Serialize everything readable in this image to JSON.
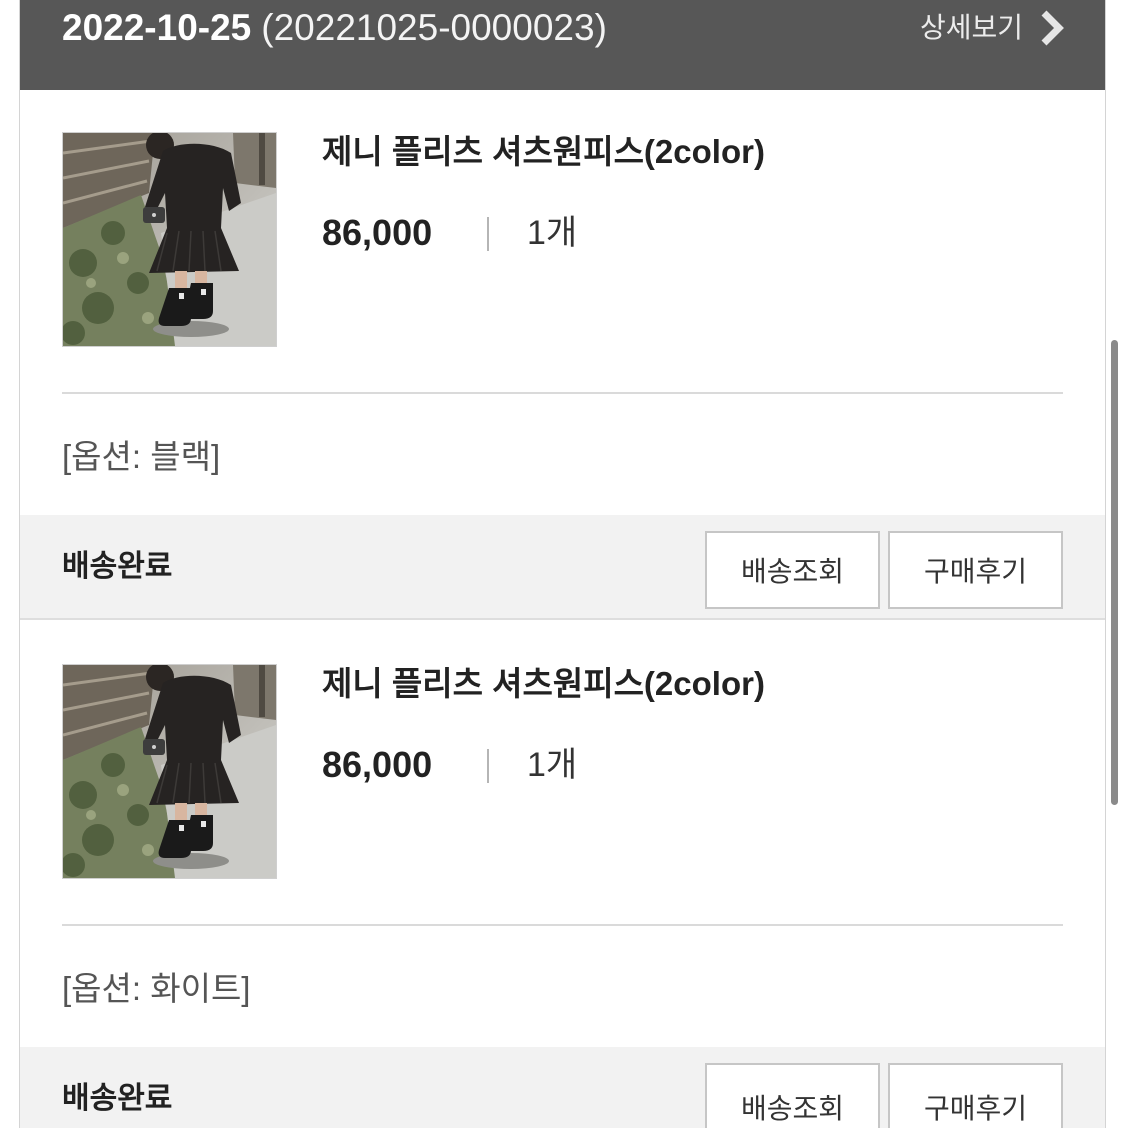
{
  "order": {
    "date": "2022-10-25",
    "number": "(20221025-0000023)",
    "detail_label": "상세보기"
  },
  "items": [
    {
      "title": "제니 플리츠 셔츠원피스(2color)",
      "price": "86,000",
      "quantity": "1개",
      "option": "[옵션: 블랙]",
      "status": "배송완료",
      "track_label": "배송조회",
      "review_label": "구매후기"
    },
    {
      "title": "제니 플리츠 셔츠원피스(2color)",
      "price": "86,000",
      "quantity": "1개",
      "option": "[옵션: 화이트]",
      "status": "배송완료",
      "track_label": "배송조회",
      "review_label": "구매후기"
    }
  ],
  "icons": {
    "detail_link": "chevron-right-icon"
  },
  "colors": {
    "header_bg": "#575757",
    "status_bar_bg": "#f2f2f2",
    "text_primary": "#222222",
    "option_text": "#555555",
    "button_border": "#c6c6c6"
  }
}
